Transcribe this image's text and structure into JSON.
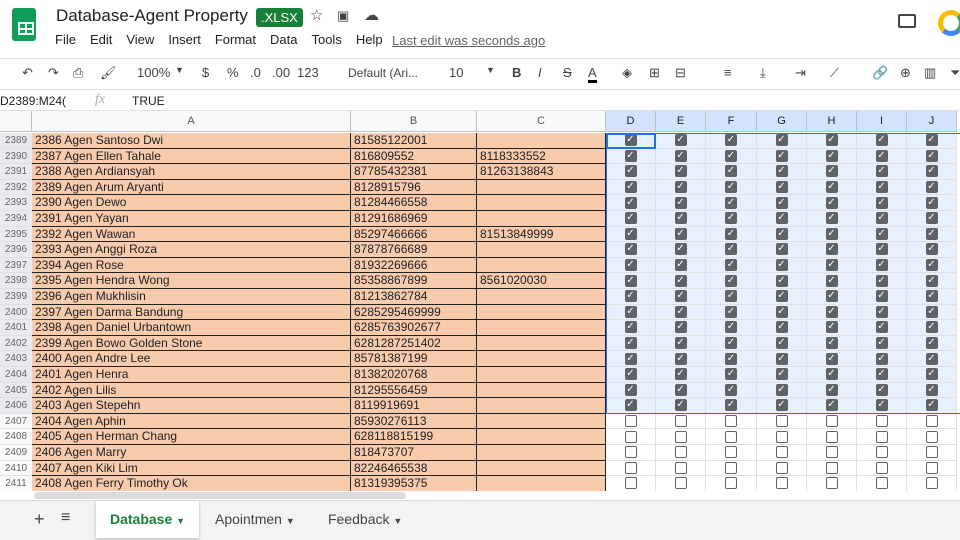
{
  "app": {
    "title": "Database-Agent Property",
    "badge": ".XLSX",
    "last_edit": "Last edit was seconds ago"
  },
  "menu": [
    "File",
    "Edit",
    "View",
    "Insert",
    "Format",
    "Data",
    "Tools",
    "Help"
  ],
  "toolbar": {
    "zoom": "100%",
    "currency": "$",
    "percent": "%",
    "dec_less": ".0",
    "dec_more": ".00",
    "format": "123",
    "font": "Default (Ari...",
    "font_size": "10",
    "bold": "B",
    "italic": "I",
    "strike": "S",
    "text_color": "A"
  },
  "formula_bar": {
    "name_box": "D2389:M24(",
    "fx": "fx",
    "value": "TRUE"
  },
  "columns": [
    "A",
    "B",
    "C",
    "D",
    "E",
    "F",
    "G",
    "H",
    "I",
    "J"
  ],
  "rows": [
    {
      "n": "2389",
      "a": "2386 Agen Santoso Dwi",
      "b": "81585122001",
      "c": "",
      "checked": true
    },
    {
      "n": "2390",
      "a": "2387 Agen Ellen Tahale",
      "b": "816809552",
      "c": "8118333552",
      "checked": true
    },
    {
      "n": "2391",
      "a": "2388 Agen Ardiansyah",
      "b": "87785432381",
      "c": "81263138843",
      "checked": true
    },
    {
      "n": "2392",
      "a": "2389 Agen Arum Aryanti",
      "b": "8128915796",
      "c": "",
      "checked": true
    },
    {
      "n": "2393",
      "a": "2390 Agen Dewo",
      "b": "81284466558",
      "c": "",
      "checked": true
    },
    {
      "n": "2394",
      "a": "2391 Agen Yayan",
      "b": "81291686969",
      "c": "",
      "checked": true
    },
    {
      "n": "2395",
      "a": "2392 Agen Wawan",
      "b": "85297466666",
      "c": "81513849999",
      "checked": true
    },
    {
      "n": "2396",
      "a": "2393 Agen Anggi Roza",
      "b": "87878766689",
      "c": "",
      "checked": true
    },
    {
      "n": "2397",
      "a": "2394 Agen Rose",
      "b": "81932269666",
      "c": "",
      "checked": true
    },
    {
      "n": "2398",
      "a": "2395 Agen Hendra Wong",
      "b": "85358867899",
      "c": "8561020030",
      "checked": true
    },
    {
      "n": "2399",
      "a": "2396 Agen Mukhlisin",
      "b": "81213862784",
      "c": "",
      "checked": true
    },
    {
      "n": "2400",
      "a": "2397 Agen Darma Bandung",
      "b": "6285295469999",
      "c": "",
      "checked": true
    },
    {
      "n": "2401",
      "a": "2398 Agen Daniel Urbantown",
      "b": "6285763902677",
      "c": "",
      "checked": true
    },
    {
      "n": "2402",
      "a": "2399 Agen Bowo Golden Stone",
      "b": "6281287251402",
      "c": "",
      "checked": true
    },
    {
      "n": "2403",
      "a": "2400 Agen Andre Lee",
      "b": "85781387199",
      "c": "",
      "checked": true
    },
    {
      "n": "2404",
      "a": "2401 Agen Henra",
      "b": "81382020768",
      "c": "",
      "checked": true
    },
    {
      "n": "2405",
      "a": "2402 Agen Lilis",
      "b": "81295556459",
      "c": "",
      "checked": true
    },
    {
      "n": "2406",
      "a": "2403 Agen Stepehn",
      "b": "8119919691",
      "c": "",
      "checked": true
    },
    {
      "n": "2407",
      "a": "2404 Agen Aphin",
      "b": "85930276113",
      "c": "",
      "checked": false
    },
    {
      "n": "2408",
      "a": "2405 Agen Herman Chang",
      "b": "628118815199",
      "c": "",
      "checked": false
    },
    {
      "n": "2409",
      "a": "2406 Agen Marry",
      "b": "818473707",
      "c": "",
      "checked": false
    },
    {
      "n": "2410",
      "a": "2407 Agen Kiki Lim",
      "b": "82246465538",
      "c": "",
      "checked": false
    },
    {
      "n": "2411",
      "a": "2408 Agen Ferry Timothy Ok",
      "b": "81319395375",
      "c": "",
      "checked": false
    }
  ],
  "sheet_tabs": [
    {
      "label": "Database",
      "active": true
    },
    {
      "label": "Apointmen",
      "active": false
    },
    {
      "label": "Feedback",
      "active": false
    }
  ],
  "colors": {
    "cell_fill": "#f8cbad",
    "accent": "#188038",
    "selection": "#1a73e8"
  }
}
